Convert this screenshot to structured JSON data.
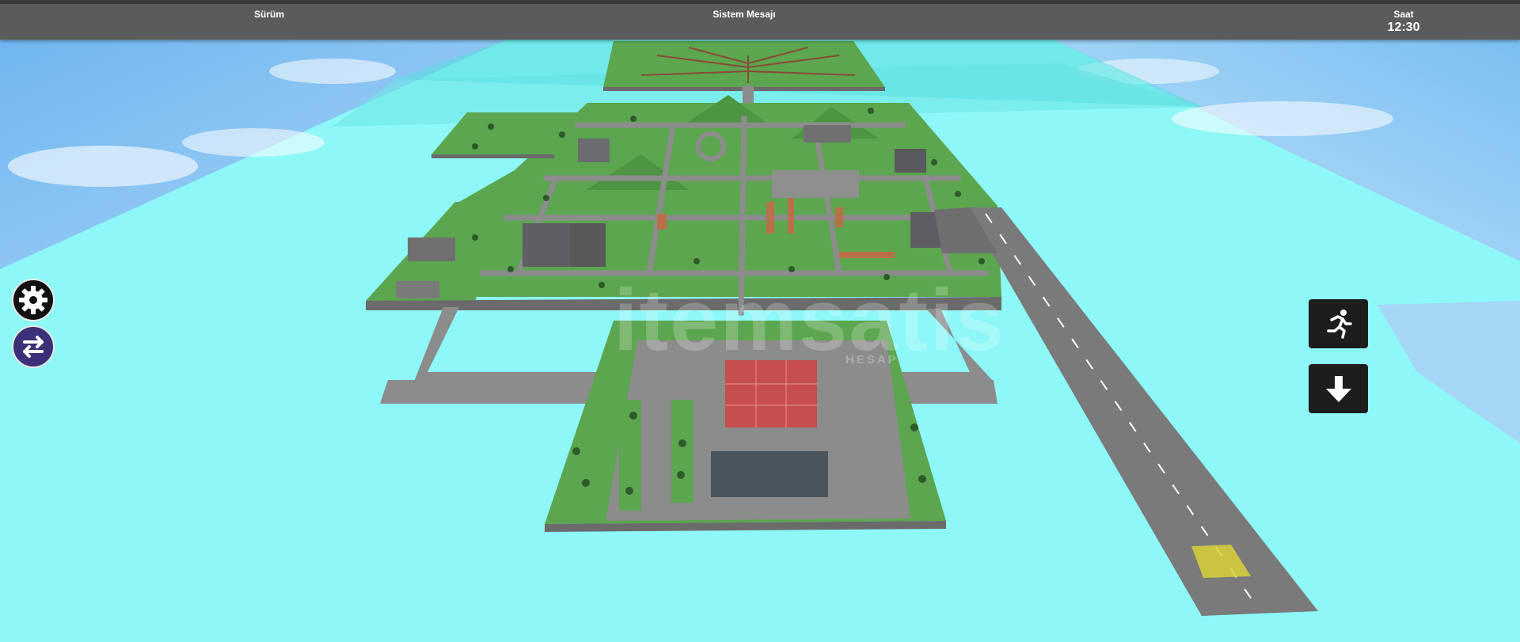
{
  "hud": {
    "version_label": "Sürüm",
    "system_message_label": "Sistem Mesajı",
    "time_label": "Saat",
    "time_value": "12:30"
  },
  "controls": {
    "settings_icon": "gear-icon",
    "switch_icon": "swap-arrows-icon",
    "run_icon": "running-person-icon",
    "down_icon": "arrow-down-icon"
  },
  "watermark": {
    "brand": "itemsatis",
    "tagline": "HESAP"
  },
  "colors": {
    "sky": "#8ef7f8",
    "grass": "#5ba64f",
    "road": "#8c8c8c",
    "hud_bar": "#5b5b5b",
    "switch_button": "#3a3178",
    "action_button": "#1d1d1d"
  }
}
